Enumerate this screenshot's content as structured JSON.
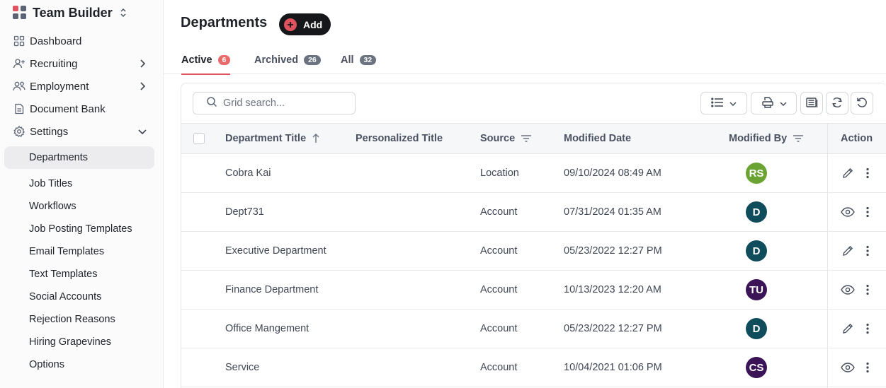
{
  "sidebar": {
    "app_name": "Team Builder",
    "nav": [
      {
        "label": "Dashboard",
        "icon": "grid-icon"
      },
      {
        "label": "Recruiting",
        "icon": "user-plus-icon"
      },
      {
        "label": "Employment",
        "icon": "users-icon"
      },
      {
        "label": "Document Bank",
        "icon": "document-icon"
      },
      {
        "label": "Settings",
        "icon": "gear-icon"
      }
    ],
    "settings_items": [
      "Departments",
      "Job Titles",
      "Workflows",
      "Job Posting Templates",
      "Email Templates",
      "Text Templates",
      "Social Accounts",
      "Rejection Reasons",
      "Hiring Grapevines",
      "Options"
    ]
  },
  "header": {
    "title": "Departments",
    "add_label": "Add"
  },
  "tabs": [
    {
      "label": "Active",
      "count": "6"
    },
    {
      "label": "Archived",
      "count": "26"
    },
    {
      "label": "All",
      "count": "32"
    }
  ],
  "grid": {
    "search_placeholder": "Grid search...",
    "columns": {
      "department_title": "Department Title",
      "personalized_title": "Personalized Title",
      "source": "Source",
      "modified_date": "Modified Date",
      "modified_by": "Modified By",
      "action": "Action"
    },
    "rows": [
      {
        "title": "Cobra Kai",
        "personalized": "",
        "source": "Location",
        "date": "09/10/2024 08:49 AM",
        "initials": "RS",
        "color": "#6aa332",
        "action": "edit"
      },
      {
        "title": "Dept731",
        "personalized": "",
        "source": "Account",
        "date": "07/31/2024 01:35 AM",
        "initials": "D",
        "color": "#0f4c5c",
        "action": "view"
      },
      {
        "title": "Executive Department",
        "personalized": "",
        "source": "Account",
        "date": "05/23/2022 12:27 PM",
        "initials": "D",
        "color": "#0f4c5c",
        "action": "edit"
      },
      {
        "title": "Finance Department",
        "personalized": "",
        "source": "Account",
        "date": "10/13/2023 12:20 AM",
        "initials": "TU",
        "color": "#3b1457",
        "action": "view"
      },
      {
        "title": "Office Mangement",
        "personalized": "",
        "source": "Account",
        "date": "05/23/2022 12:27 PM",
        "initials": "D",
        "color": "#0f4c5c",
        "action": "edit"
      },
      {
        "title": "Service",
        "personalized": "",
        "source": "Account",
        "date": "10/04/2021 01:06 PM",
        "initials": "CS",
        "color": "#3b1457",
        "action": "view"
      }
    ]
  },
  "colors": {
    "accent": "#e0525d",
    "dark": "#15171a"
  }
}
